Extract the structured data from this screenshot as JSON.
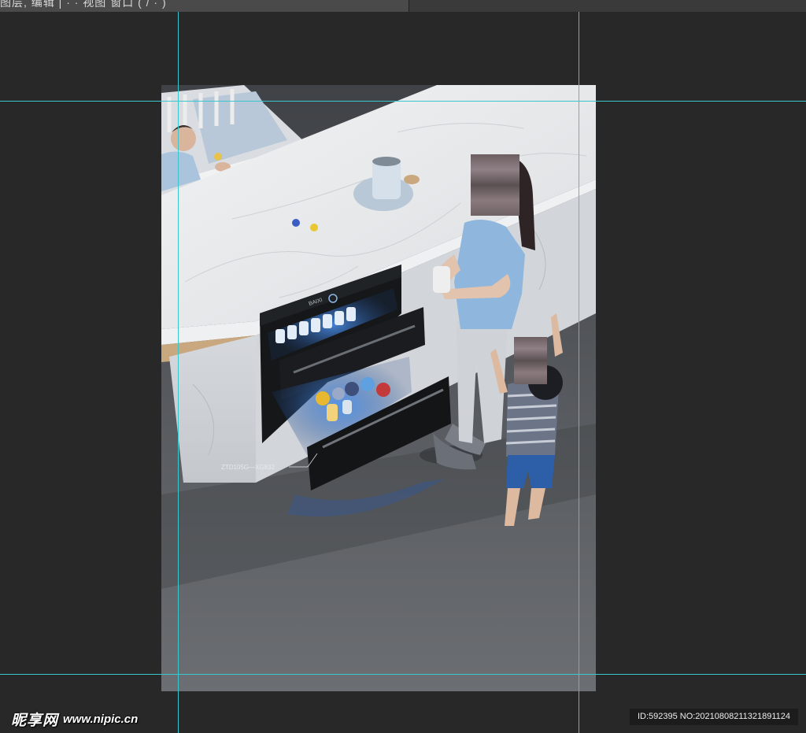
{
  "app": {
    "tab_text": "图层, 编辑 |   ·   ·   视图      窗口 (  / ·  )"
  },
  "canvas": {
    "model_label": "ZTD105G—XG832",
    "brand_mark": "BAIXI"
  },
  "watermark": {
    "brand": "昵享网",
    "url": "www.nipic.cn"
  },
  "image_info": {
    "id_text": "ID:592395 NO:20210808211321891124"
  },
  "colors": {
    "workspace_bg": "#282828",
    "guide_color": "#39c6cc",
    "marble": "#e6e8ea",
    "floor": "#4d4f52"
  }
}
